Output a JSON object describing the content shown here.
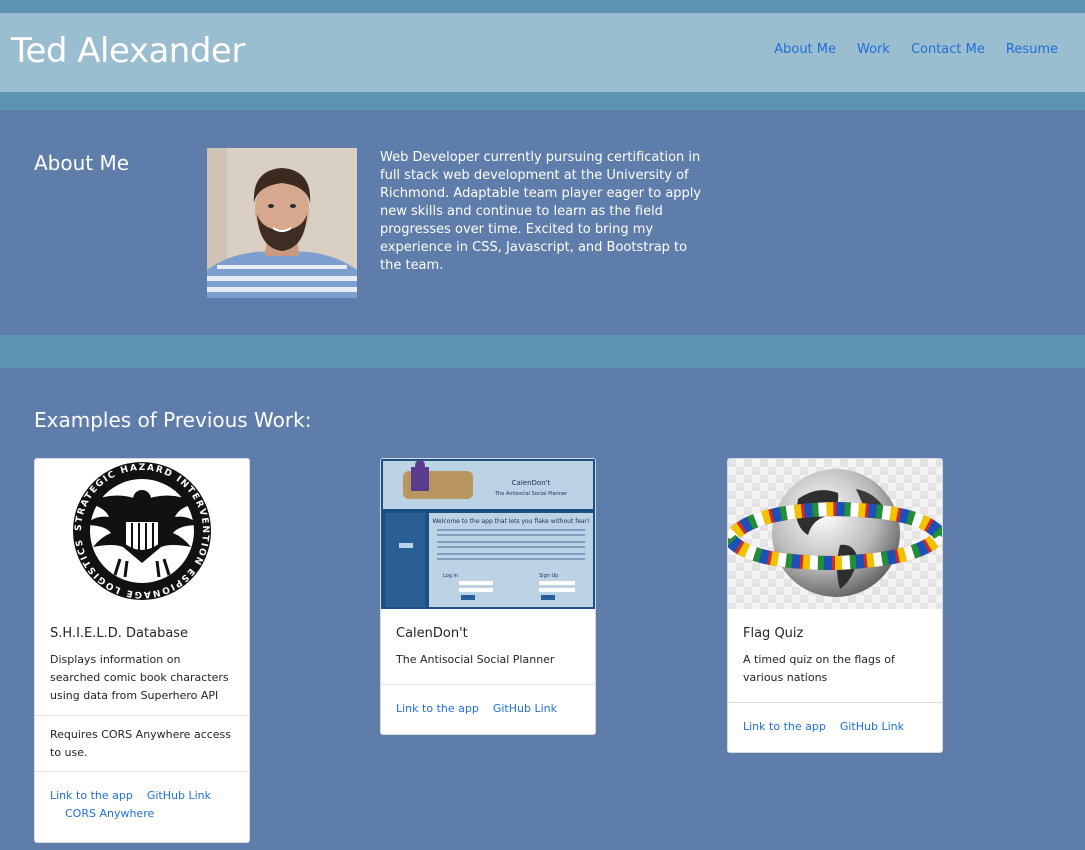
{
  "header": {
    "site_title": "Ted Alexander",
    "nav": [
      "About Me",
      "Work",
      "Contact Me",
      "Resume"
    ]
  },
  "about": {
    "heading": "About Me",
    "text": "Web Developer currently pursuing certification in full stack web development at the University of Richmond. Adaptable team player eager to apply new skills and continue to learn as the field progresses over time. Excited to bring my experience in CSS, Javascript, and Bootstrap to the team."
  },
  "work": {
    "heading": "Examples of Previous Work:",
    "cards": [
      {
        "title": "S.H.I.E.L.D. Database",
        "text": "Displays information on searched comic book characters using data from Superhero API",
        "note": "Requires CORS Anywhere access to use.",
        "links": [
          "Link to the app",
          "GitHub Link",
          "CORS Anywhere"
        ],
        "logo_words": "STRATEGIC HAZARD INTERVENTION ESPIONAGE LOGISTICS DIRECTORATE"
      },
      {
        "title": "CalenDon't",
        "text": "The Antisocial Social Planner",
        "links": [
          "Link to the app",
          "GitHub Link"
        ],
        "screenshot": {
          "app_name": "CalenDon't",
          "tagline": "The Antisocial Social Planner",
          "welcome": "Welcome to the app that lets you flake without fear!",
          "login": "Log in",
          "signup": "Sign Up"
        }
      },
      {
        "title": "Flag Quiz",
        "text": "A timed quiz on the flags of various nations",
        "links": [
          "Link to the app",
          "GitHub Link"
        ]
      }
    ]
  },
  "colors": {
    "band": "#5a94b1",
    "header": "#9bbdd0",
    "section": "#5f7dab",
    "link": "#1f6fd6"
  }
}
